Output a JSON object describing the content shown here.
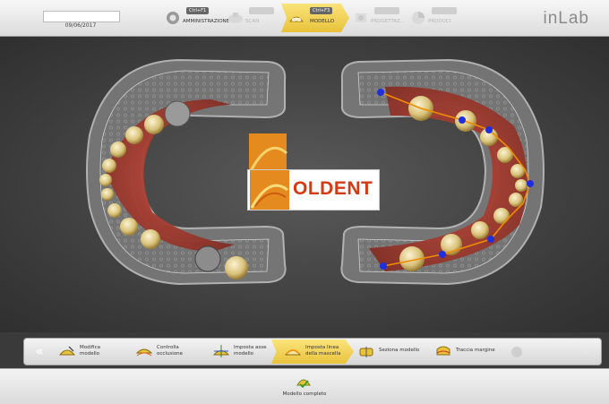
{
  "header": {
    "date": "09/06/2017",
    "brand": "inLab",
    "steps": [
      {
        "key": "Ctrl+F1",
        "label": "AMMINISTRAZIONE",
        "state": "done"
      },
      {
        "key": "",
        "label": "SCAN",
        "state": "disabled"
      },
      {
        "key": "Ctrl+F3",
        "label": "MODELLO",
        "state": "active"
      },
      {
        "key": "",
        "label": "PROGETTAZ...",
        "state": "disabled"
      },
      {
        "key": "",
        "label": "PRODUCI",
        "state": "disabled"
      }
    ]
  },
  "viewport": {
    "logo_text": "OLDENT"
  },
  "toolbar": {
    "prev": "«",
    "next": "»",
    "tools": [
      {
        "label": "Modifica\nmodello",
        "icon": "edit-model-icon",
        "state": "normal"
      },
      {
        "label": "Controlla\nocclusione",
        "icon": "check-occlusion-icon",
        "state": "normal"
      },
      {
        "label": "Imposta asse\nmodello",
        "icon": "model-axis-icon",
        "state": "normal"
      },
      {
        "label": "Imposta linea\ndella mascella",
        "icon": "jaw-line-icon",
        "state": "active"
      },
      {
        "label": "Seziona modello",
        "icon": "section-model-icon",
        "state": "normal"
      },
      {
        "label": "Traccia margine",
        "icon": "trace-margin-icon",
        "state": "normal"
      },
      {
        "label": "",
        "icon": "disabled-tool-icon",
        "state": "disabled"
      }
    ]
  },
  "bottom": {
    "label": "Modello completo"
  },
  "colors": {
    "accent": "#e9c33c",
    "jaw_line": "#f08c00",
    "point": "#1f2fe0",
    "gum": "#b0443a"
  }
}
